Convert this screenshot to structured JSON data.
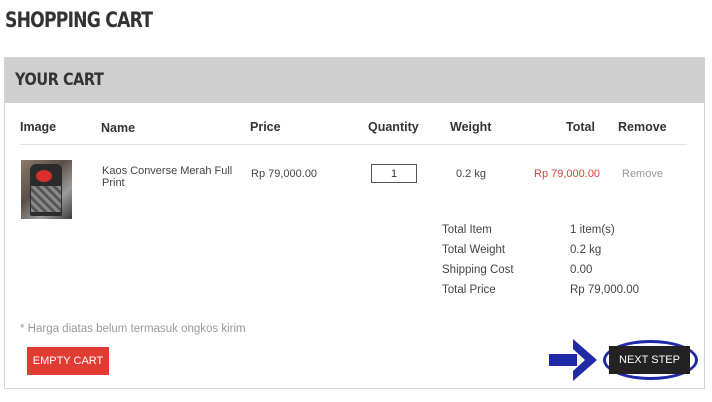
{
  "page": {
    "title": "SHOPPING CART"
  },
  "cart": {
    "title": "YOUR CART",
    "columns": {
      "image": "Image",
      "name": "Name",
      "price": "Price",
      "quantity": "Quantity",
      "weight": "Weight",
      "total": "Total",
      "remove": "Remove"
    },
    "items": [
      {
        "image_icon": "tshirt-product-photo",
        "name": "Kaos Converse Merah Full Print",
        "price": "Rp 79,000.00",
        "quantity": "1",
        "weight": "0.2 kg",
        "total": "Rp 79,000.00",
        "remove": "Remove"
      }
    ],
    "summary": {
      "total_item_label": "Total Item",
      "total_item_value": "1 item(s)",
      "total_weight_label": "Total Weight",
      "total_weight_value": "0.2 kg",
      "shipping_cost_label": "Shipping Cost",
      "shipping_cost_value": "0.00",
      "total_price_label": "Total Price",
      "total_price_value": "Rp 79,000.00"
    },
    "note": "* Harga diatas belum termasuk ongkos kirim",
    "empty_button": "EMPTY CART",
    "next_button": "NEXT STEP"
  },
  "colors": {
    "header_bg": "#cfcfcf",
    "empty_button": "#e03c32",
    "next_button": "#222222",
    "highlight": "#1e2aa8",
    "price_red": "#d9443a"
  },
  "annotation": {
    "arrow_icon": "right-arrow-icon"
  }
}
